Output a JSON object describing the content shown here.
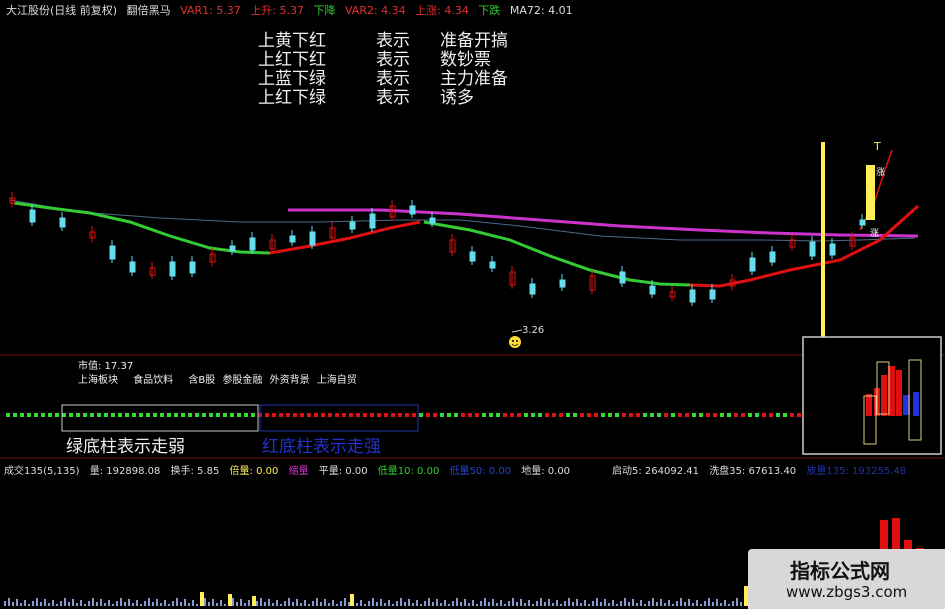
{
  "header": {
    "stock": "大江股份(日线 前复权)",
    "indicator": "翻倍黑马",
    "var1": "VAR1: 5.37",
    "up": "上升: 5.37",
    "down": "下降",
    "var2": "VAR2: 4.34",
    "up2": "上涨: 4.34",
    "fall": "下跌",
    "ma": "MA72: 4.01"
  },
  "legend": [
    {
      "a": "上黄下红",
      "b": "表示",
      "c": "准备开搞"
    },
    {
      "a": "上红下红",
      "b": "表示",
      "c": "数钞票"
    },
    {
      "a": "上蓝下绿",
      "b": "表示",
      "c": "主力准备"
    },
    {
      "a": "上红下绿",
      "b": "表示",
      "c": "诱多"
    }
  ],
  "chart_labels": {
    "low_mark": "3.26",
    "top_t": "T",
    "zhang1": "涨",
    "zhang2": "涨"
  },
  "info": {
    "market_cap": "市值: 17.37",
    "sectors": [
      "上海板块",
      "食品饮料",
      "含B股",
      "参股金融",
      "外资背景",
      "上海自贸"
    ]
  },
  "captions": {
    "green": "绿底柱表示走弱",
    "red": "红底柱表示走强"
  },
  "volume_header": {
    "name": "成交135(5,135)",
    "vol": "量: 192898.08",
    "turnover": "换手: 5.85",
    "double": "倍量: 0.00",
    "shrink": "缩量",
    "flat": "平量: 0.00",
    "low": "低量10: 0.00",
    "low50": "低量50: 0.00",
    "ground": "地量: 0.00",
    "start": "启动5: 264092.41",
    "wash": "洗盘35: 67613.40",
    "extra": "放量135: 193255.48"
  },
  "watermark": {
    "title": "指标公式网",
    "url": "www.zbgs3.com"
  },
  "colors": {
    "bg": "#000000",
    "green": "#33cc33",
    "red": "#e01010",
    "magenta": "#cc33cc",
    "yellow": "#ffee55",
    "cyan": "#66ddee"
  }
}
